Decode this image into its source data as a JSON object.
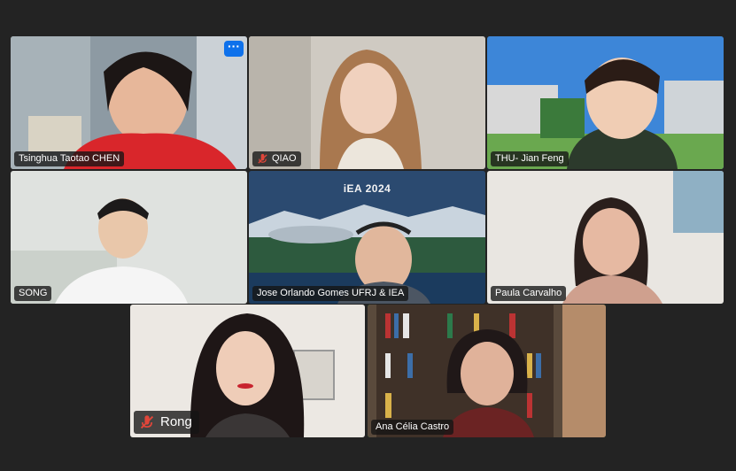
{
  "participants": [
    {
      "name": "Tsinghua Taotao CHEN",
      "muted": false
    },
    {
      "name": "QIAO",
      "muted": true
    },
    {
      "name": "THU- Jian Feng",
      "muted": false
    },
    {
      "name": "SONG",
      "muted": false
    },
    {
      "name": "Jose Orlando Gomes UFRJ & IEA",
      "muted": false
    },
    {
      "name": "Paula Carvalho",
      "muted": false
    },
    {
      "name": "Rong",
      "muted": true
    },
    {
      "name": "Ana Célia Castro",
      "muted": false,
      "active_speaker": true
    }
  ],
  "shared_slide": {
    "title": "iEA 2024"
  },
  "menu": {
    "more_label": "···",
    "icon": "more-icon"
  },
  "colors": {
    "background": "#232323",
    "active_speaker_border": "#22c132",
    "menu_button": "#0e71eb",
    "mute_icon": "#e0463a"
  }
}
